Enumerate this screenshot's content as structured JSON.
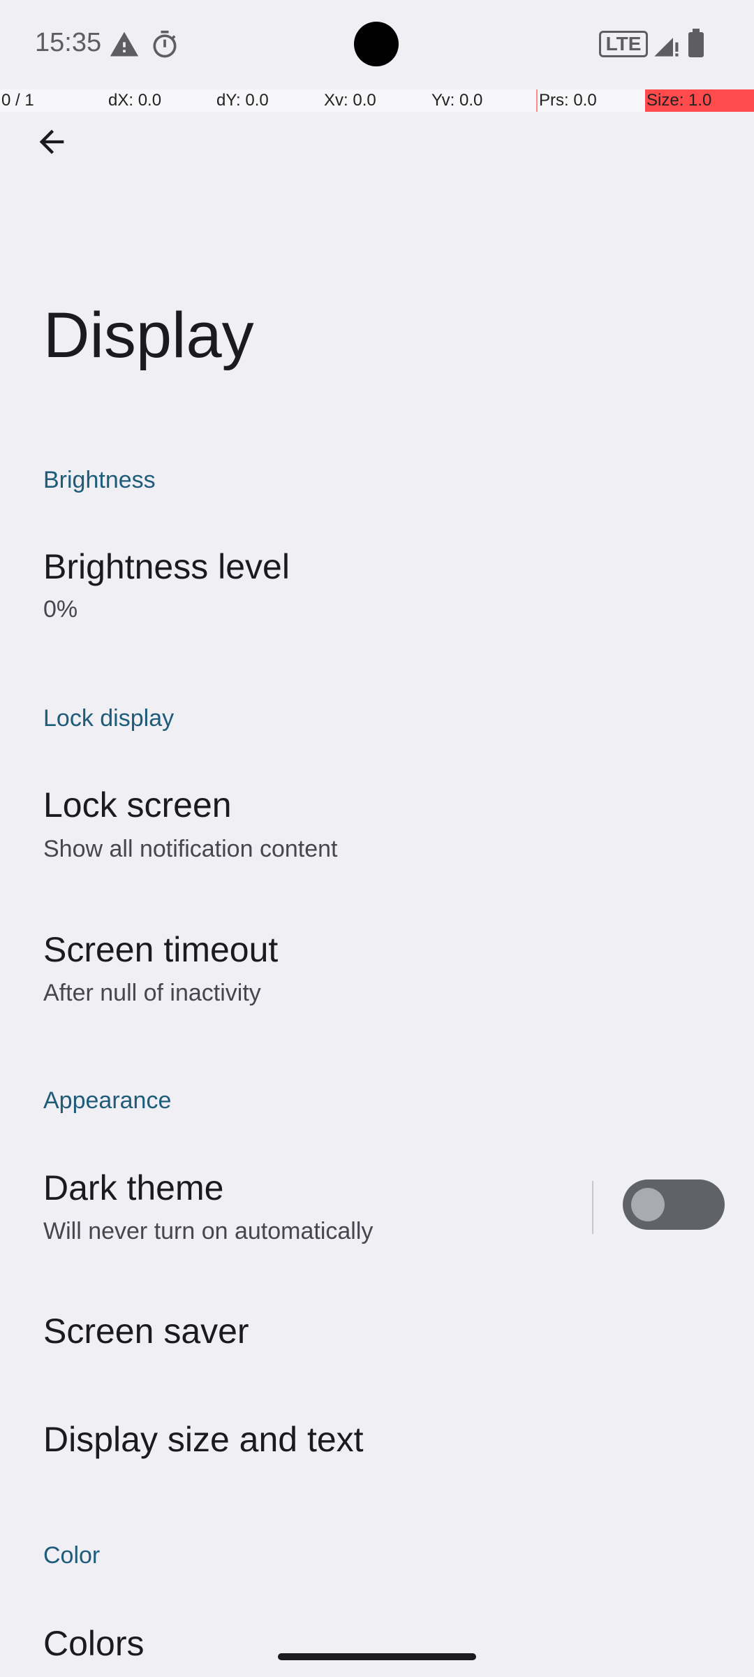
{
  "status_bar": {
    "time": "15:35",
    "icons": [
      "warning-icon",
      "timer-icon"
    ],
    "network": "LTE",
    "signal_icon": "signal-icon",
    "battery_icon": "battery-icon"
  },
  "pointer_debug": {
    "pointers": "0 / 1",
    "dx": "dX: 0.0",
    "dy": "dY: 0.0",
    "xv": "Xv: 0.0",
    "yv": "Yv: 0.0",
    "prs": "Prs: 0.0",
    "size": "Size: 1.0"
  },
  "header": {
    "back_icon": "arrow-back-icon",
    "title": "Display"
  },
  "sections": {
    "brightness": {
      "header": "Brightness",
      "level_title": "Brightness level",
      "level_value": "0%"
    },
    "lock_display": {
      "header": "Lock display",
      "lock_screen_title": "Lock screen",
      "lock_screen_summary": "Show all notification content",
      "timeout_title": "Screen timeout",
      "timeout_summary": "After null of inactivity"
    },
    "appearance": {
      "header": "Appearance",
      "dark_theme_title": "Dark theme",
      "dark_theme_summary": "Will never turn on automatically",
      "dark_theme_on": false,
      "screen_saver_title": "Screen saver",
      "display_size_title": "Display size and text"
    },
    "color": {
      "header": "Color",
      "colors_title": "Colors"
    }
  },
  "colors": {
    "background": "#F0EFF4",
    "section_header": "#1F5C7A",
    "toggle_track_off": "#5F6368",
    "debug_size_bg": "#FF4B4B"
  }
}
